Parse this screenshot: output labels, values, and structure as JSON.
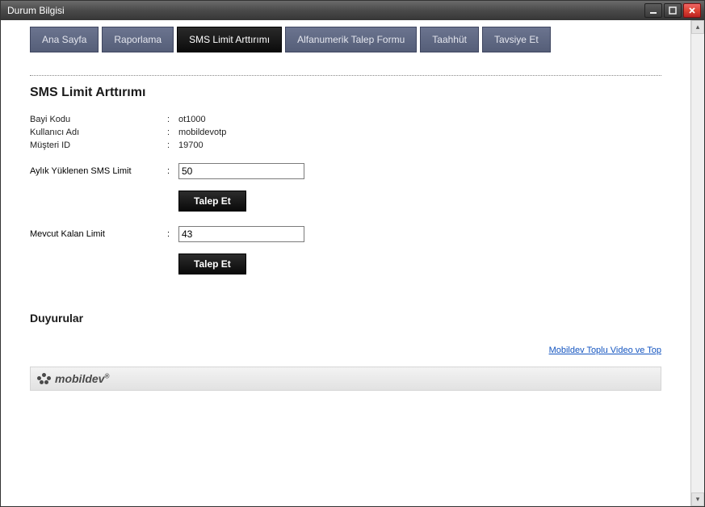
{
  "window": {
    "title": "Durum Bilgisi"
  },
  "tabs": {
    "home": "Ana Sayfa",
    "reporting": "Raporlama",
    "sms_limit": "SMS Limit Arttırımı",
    "alphanumeric": "Alfanumerik Talep Formu",
    "commitment": "Taahhüt",
    "recommend": "Tavsiye Et"
  },
  "section": {
    "title": "SMS Limit Arttırımı",
    "dealer_code_label": "Bayi Kodu",
    "dealer_code_value": "ot1000",
    "username_label": "Kullanıcı Adı",
    "username_value": "mobildevotp",
    "customer_id_label": "Müşteri ID",
    "customer_id_value": "19700",
    "monthly_limit_label": "Aylık Yüklenen SMS Limit",
    "monthly_limit_value": "50",
    "request_btn_1": "Talep Et",
    "remaining_limit_label": "Mevcut Kalan Limit",
    "remaining_limit_value": "43",
    "request_btn_2": "Talep Et"
  },
  "announcements": {
    "title": "Duyurular",
    "link": "Mobildev Toplu Video ve Top"
  },
  "footer": {
    "brand": "mobildev",
    "brand_suffix": "®"
  }
}
